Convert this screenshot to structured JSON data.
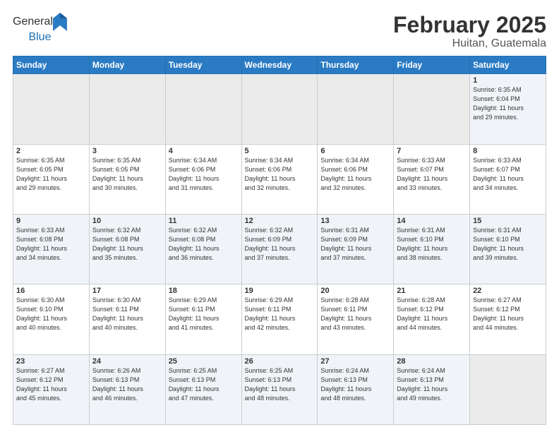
{
  "header": {
    "logo_general": "General",
    "logo_blue": "Blue",
    "title": "February 2025",
    "location": "Huitan, Guatemala"
  },
  "weekdays": [
    "Sunday",
    "Monday",
    "Tuesday",
    "Wednesday",
    "Thursday",
    "Friday",
    "Saturday"
  ],
  "weeks": [
    [
      {
        "day": "",
        "info": ""
      },
      {
        "day": "",
        "info": ""
      },
      {
        "day": "",
        "info": ""
      },
      {
        "day": "",
        "info": ""
      },
      {
        "day": "",
        "info": ""
      },
      {
        "day": "",
        "info": ""
      },
      {
        "day": "1",
        "info": "Sunrise: 6:35 AM\nSunset: 6:04 PM\nDaylight: 11 hours\nand 29 minutes."
      }
    ],
    [
      {
        "day": "2",
        "info": "Sunrise: 6:35 AM\nSunset: 6:05 PM\nDaylight: 11 hours\nand 29 minutes."
      },
      {
        "day": "3",
        "info": "Sunrise: 6:35 AM\nSunset: 6:05 PM\nDaylight: 11 hours\nand 30 minutes."
      },
      {
        "day": "4",
        "info": "Sunrise: 6:34 AM\nSunset: 6:06 PM\nDaylight: 11 hours\nand 31 minutes."
      },
      {
        "day": "5",
        "info": "Sunrise: 6:34 AM\nSunset: 6:06 PM\nDaylight: 11 hours\nand 32 minutes."
      },
      {
        "day": "6",
        "info": "Sunrise: 6:34 AM\nSunset: 6:06 PM\nDaylight: 11 hours\nand 32 minutes."
      },
      {
        "day": "7",
        "info": "Sunrise: 6:33 AM\nSunset: 6:07 PM\nDaylight: 11 hours\nand 33 minutes."
      },
      {
        "day": "8",
        "info": "Sunrise: 6:33 AM\nSunset: 6:07 PM\nDaylight: 11 hours\nand 34 minutes."
      }
    ],
    [
      {
        "day": "9",
        "info": "Sunrise: 6:33 AM\nSunset: 6:08 PM\nDaylight: 11 hours\nand 34 minutes."
      },
      {
        "day": "10",
        "info": "Sunrise: 6:32 AM\nSunset: 6:08 PM\nDaylight: 11 hours\nand 35 minutes."
      },
      {
        "day": "11",
        "info": "Sunrise: 6:32 AM\nSunset: 6:08 PM\nDaylight: 11 hours\nand 36 minutes."
      },
      {
        "day": "12",
        "info": "Sunrise: 6:32 AM\nSunset: 6:09 PM\nDaylight: 11 hours\nand 37 minutes."
      },
      {
        "day": "13",
        "info": "Sunrise: 6:31 AM\nSunset: 6:09 PM\nDaylight: 11 hours\nand 37 minutes."
      },
      {
        "day": "14",
        "info": "Sunrise: 6:31 AM\nSunset: 6:10 PM\nDaylight: 11 hours\nand 38 minutes."
      },
      {
        "day": "15",
        "info": "Sunrise: 6:31 AM\nSunset: 6:10 PM\nDaylight: 11 hours\nand 39 minutes."
      }
    ],
    [
      {
        "day": "16",
        "info": "Sunrise: 6:30 AM\nSunset: 6:10 PM\nDaylight: 11 hours\nand 40 minutes."
      },
      {
        "day": "17",
        "info": "Sunrise: 6:30 AM\nSunset: 6:11 PM\nDaylight: 11 hours\nand 40 minutes."
      },
      {
        "day": "18",
        "info": "Sunrise: 6:29 AM\nSunset: 6:11 PM\nDaylight: 11 hours\nand 41 minutes."
      },
      {
        "day": "19",
        "info": "Sunrise: 6:29 AM\nSunset: 6:11 PM\nDaylight: 11 hours\nand 42 minutes."
      },
      {
        "day": "20",
        "info": "Sunrise: 6:28 AM\nSunset: 6:11 PM\nDaylight: 11 hours\nand 43 minutes."
      },
      {
        "day": "21",
        "info": "Sunrise: 6:28 AM\nSunset: 6:12 PM\nDaylight: 11 hours\nand 44 minutes."
      },
      {
        "day": "22",
        "info": "Sunrise: 6:27 AM\nSunset: 6:12 PM\nDaylight: 11 hours\nand 44 minutes."
      }
    ],
    [
      {
        "day": "23",
        "info": "Sunrise: 6:27 AM\nSunset: 6:12 PM\nDaylight: 11 hours\nand 45 minutes."
      },
      {
        "day": "24",
        "info": "Sunrise: 6:26 AM\nSunset: 6:13 PM\nDaylight: 11 hours\nand 46 minutes."
      },
      {
        "day": "25",
        "info": "Sunrise: 6:25 AM\nSunset: 6:13 PM\nDaylight: 11 hours\nand 47 minutes."
      },
      {
        "day": "26",
        "info": "Sunrise: 6:25 AM\nSunset: 6:13 PM\nDaylight: 11 hours\nand 48 minutes."
      },
      {
        "day": "27",
        "info": "Sunrise: 6:24 AM\nSunset: 6:13 PM\nDaylight: 11 hours\nand 48 minutes."
      },
      {
        "day": "28",
        "info": "Sunrise: 6:24 AM\nSunset: 6:13 PM\nDaylight: 11 hours\nand 49 minutes."
      },
      {
        "day": "",
        "info": ""
      }
    ]
  ]
}
